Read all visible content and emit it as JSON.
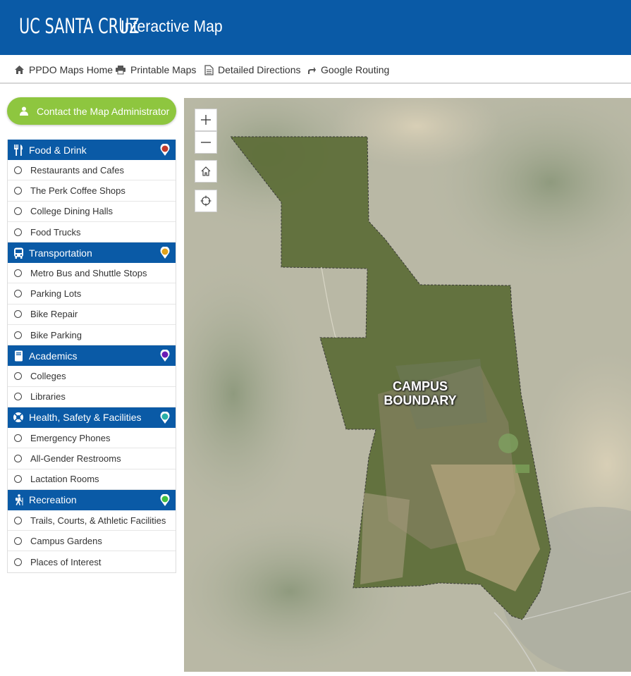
{
  "header": {
    "logo": "UC SANTA CRUZ",
    "title": "Interactive Map",
    "background": "#0a5aa6"
  },
  "nav": {
    "home": "PPDO Maps Home",
    "printable": "Printable Maps",
    "directions": "Detailed Directions",
    "routing": "Google Routing"
  },
  "contact": {
    "label": "Contact the Map Administrator",
    "color": "#8ec63f"
  },
  "categories": [
    {
      "label": "Food & Drink",
      "icon": "utensils-icon",
      "pin_color": "#c0392b",
      "items": [
        "Restaurants and Cafes",
        "The Perk Coffee Shops",
        "College Dining Halls",
        "Food Trucks"
      ]
    },
    {
      "label": "Transportation",
      "icon": "bus-icon",
      "pin_color": "#e0a21b",
      "items": [
        "Metro Bus and Shuttle Stops",
        "Parking Lots",
        "Bike Repair",
        "Bike Parking"
      ]
    },
    {
      "label": "Academics",
      "icon": "book-icon",
      "pin_color": "#6a1bb5",
      "items": [
        "Colleges",
        "Libraries"
      ]
    },
    {
      "label": "Health, Safety & Facilities",
      "icon": "lifebuoy-icon",
      "pin_color": "#29b0a8",
      "items": [
        "Emergency Phones",
        "All-Gender Restrooms",
        "Lactation Rooms"
      ]
    },
    {
      "label": "Recreation",
      "icon": "hiker-icon",
      "pin_color": "#3fbf3f",
      "items": [
        "Trails, Courts, & Athletic Facilities",
        "Campus Gardens",
        "Places of Interest"
      ]
    }
  ],
  "map": {
    "label_line1": "CAMPUS",
    "label_line2": "BOUNDARY"
  }
}
